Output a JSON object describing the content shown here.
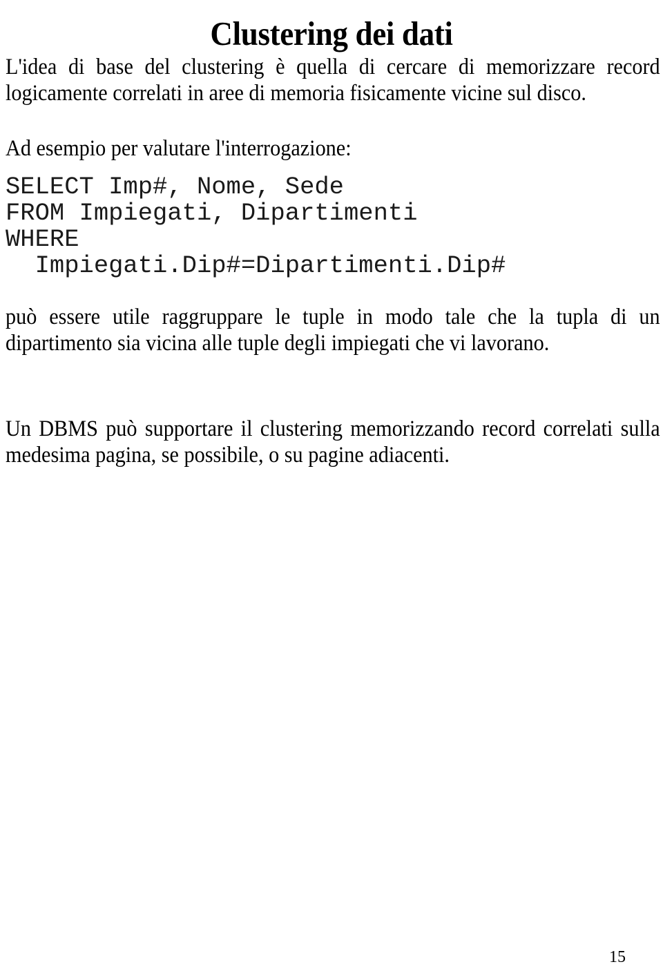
{
  "document": {
    "title": "Clustering dei dati",
    "page_number": "15",
    "language": "it"
  },
  "paragraphs": {
    "intro": "L'idea di base del clustering è quella di cercare di memorizzare record logicamente correlati in aree di memoria fisicamente vicine sul disco.",
    "example_lead": "Ad esempio per valutare l'interrogazione:",
    "after_code": "può essere utile raggruppare le tuple in modo tale che la tupla di un dipartimento sia vicina alle tuple degli impiegati che vi lavorano.",
    "conclusion": "Un DBMS può supportare il clustering memorizzando record correlati sulla medesima pagina, se possibile, o su pagine adiacenti."
  },
  "code_block": {
    "language": "sql",
    "lines": [
      "SELECT Imp#, Nome, Sede",
      "FROM Impiegati, Dipartimenti",
      "WHERE",
      "  Impiegati.Dip#=Dipartimenti.Dip#"
    ],
    "text": "SELECT Imp#, Nome, Sede\nFROM Impiegati, Dipartimenti\nWHERE\n  Impiegati.Dip#=Dipartimenti.Dip#"
  },
  "colors": {
    "page_background": "#ffffff",
    "text": "#000000",
    "code_text": "#1a1a1a"
  }
}
